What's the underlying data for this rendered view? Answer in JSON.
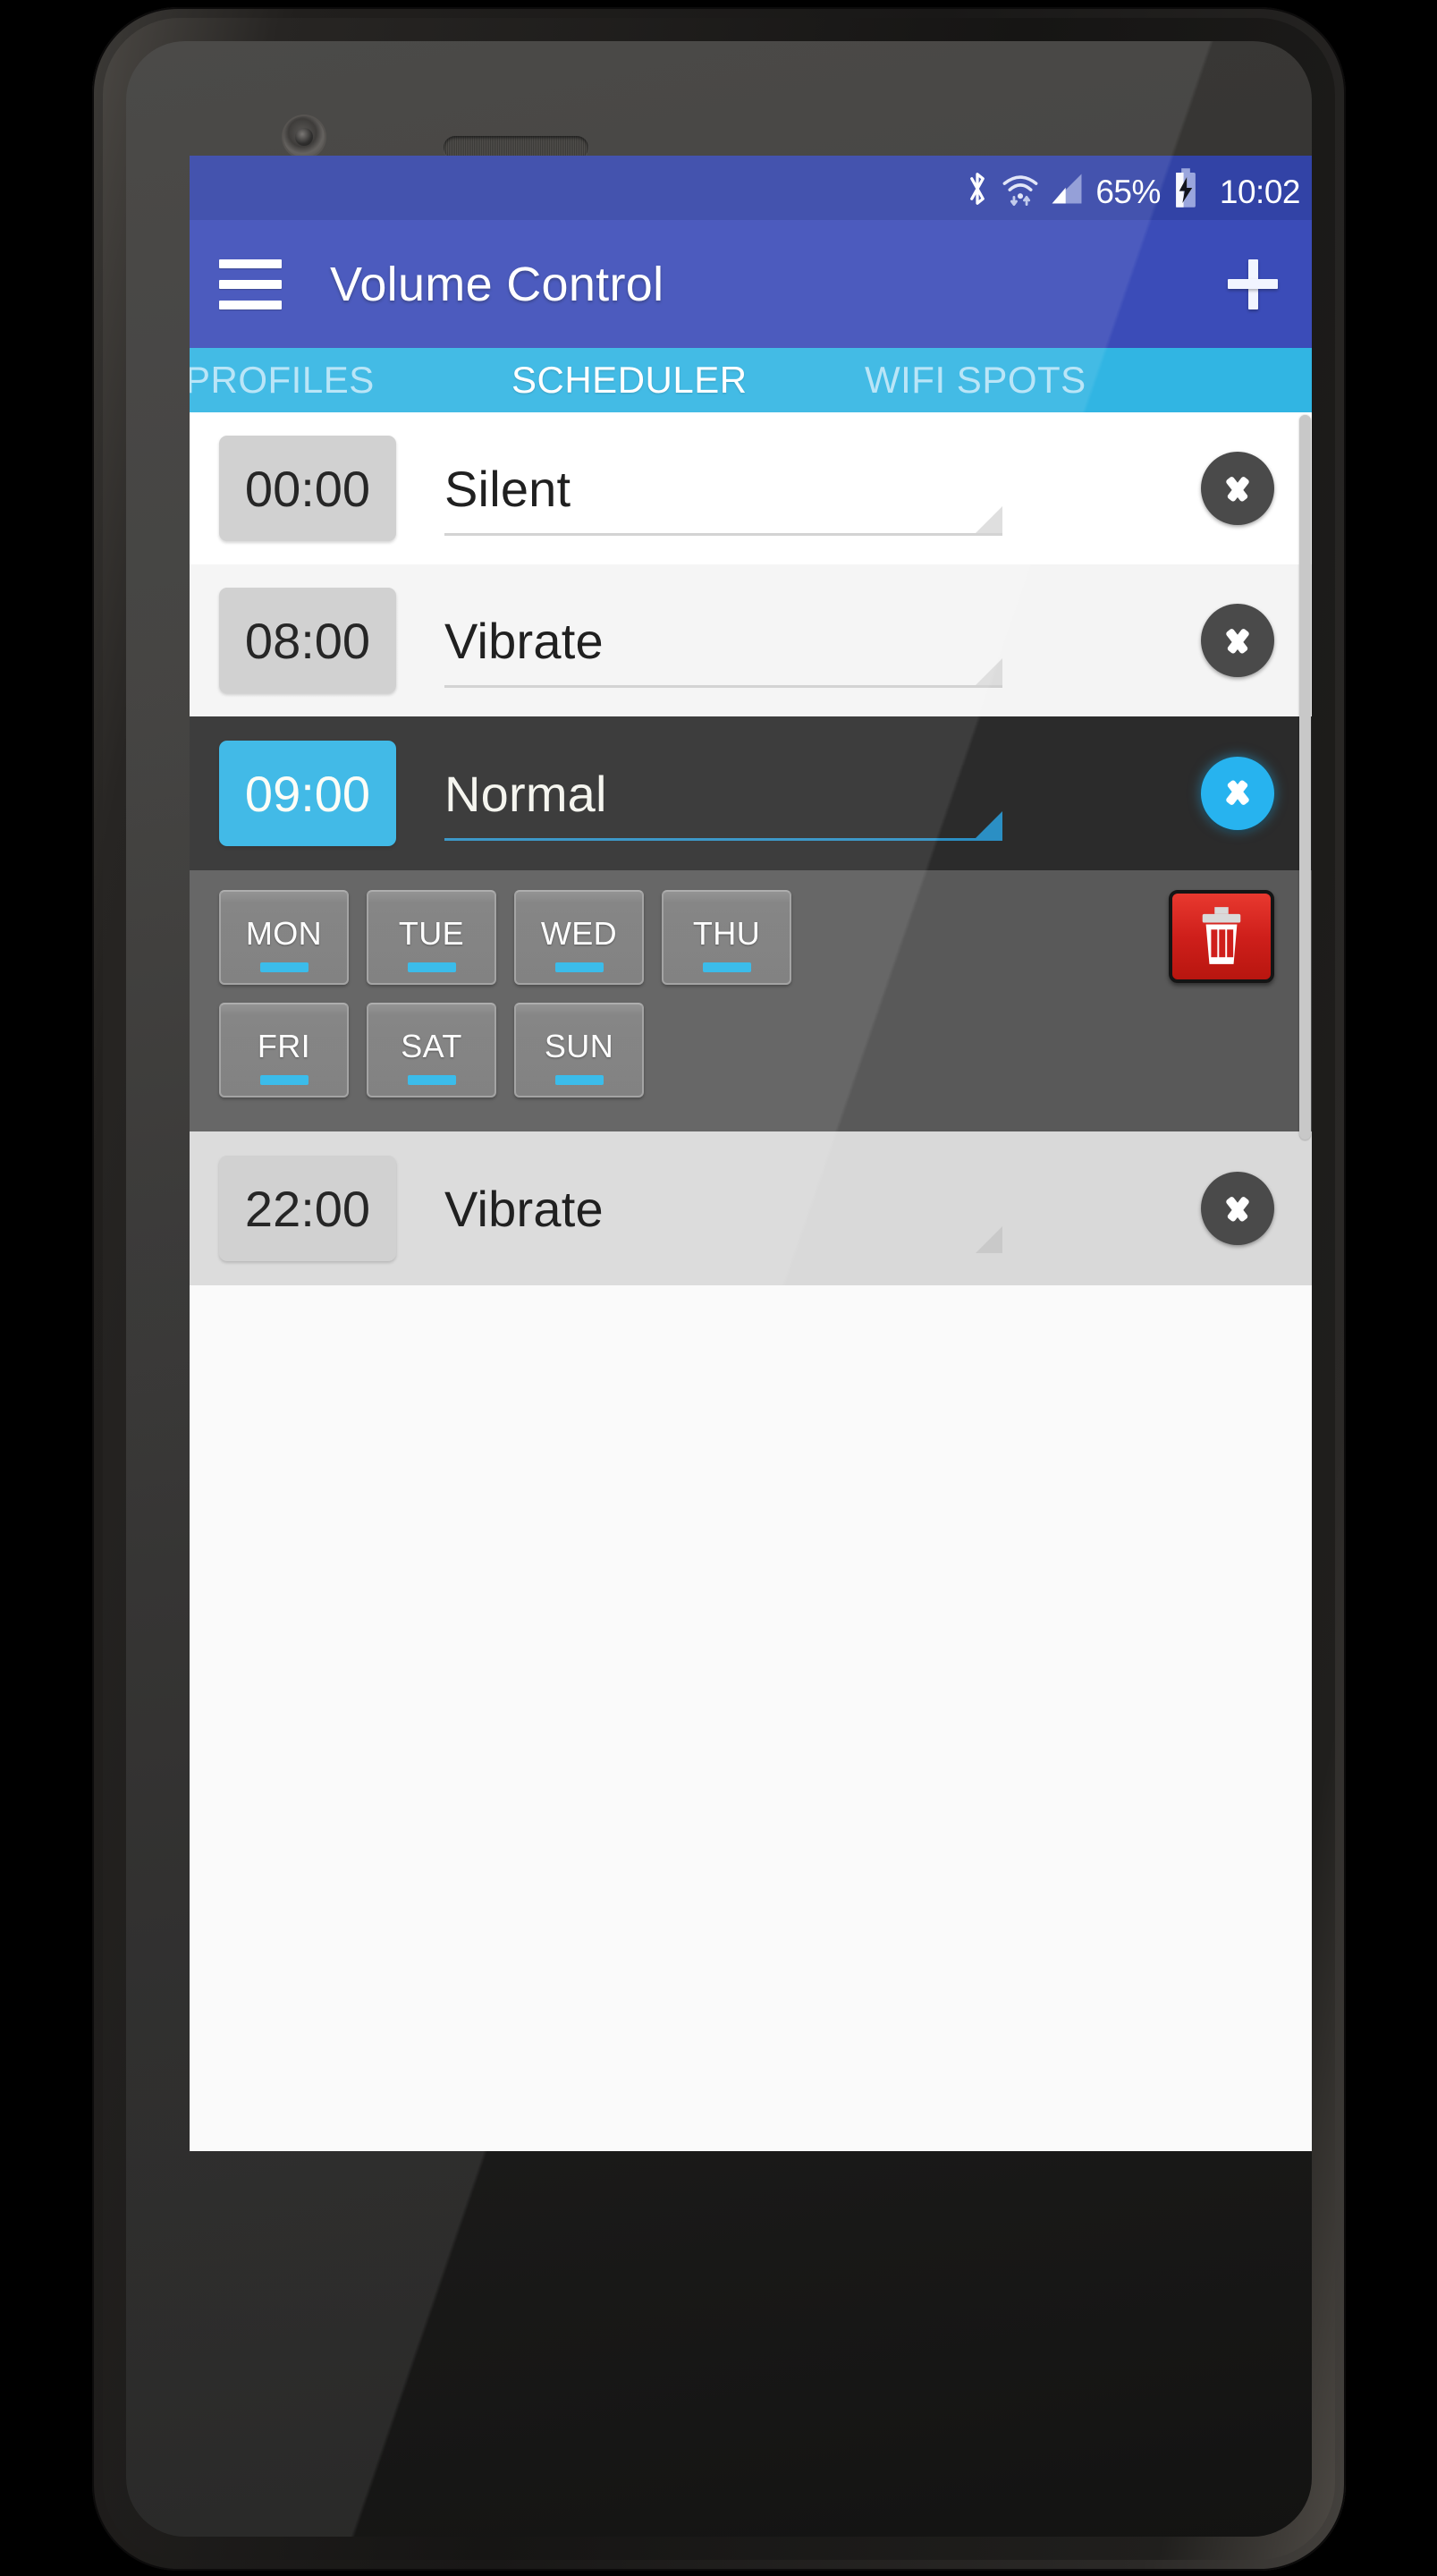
{
  "status_bar": {
    "battery_percent": "65%",
    "clock": "10:02",
    "icons": [
      "bluetooth-icon",
      "wifi-icon",
      "cellular-signal-icon",
      "battery-charging-icon"
    ],
    "background_color": "#3243a6"
  },
  "app_bar": {
    "title": "Volume Control",
    "menu_icon": "hamburger-menu-icon",
    "add_icon": "plus-icon",
    "background_color": "#3b4cb8"
  },
  "tabs": {
    "background_color": "#31b5e3",
    "active_index": 1,
    "items": [
      {
        "label": "PROFILES",
        "active": false
      },
      {
        "label": "SCHEDULER",
        "active": true
      },
      {
        "label": "WIFI SPOTS",
        "active": false
      }
    ]
  },
  "scheduler": {
    "rows": [
      {
        "time": "00:00",
        "profile": "Silent",
        "expanded": false
      },
      {
        "time": "08:00",
        "profile": "Vibrate",
        "expanded": false
      },
      {
        "time": "09:00",
        "profile": "Normal",
        "expanded": true
      },
      {
        "time": "22:00",
        "profile": "Vibrate",
        "expanded": false
      }
    ],
    "expanded_row": {
      "days": [
        {
          "label": "MON",
          "enabled": true
        },
        {
          "label": "TUE",
          "enabled": true
        },
        {
          "label": "WED",
          "enabled": true
        },
        {
          "label": "THU",
          "enabled": true
        },
        {
          "label": "FRI",
          "enabled": true
        },
        {
          "label": "SAT",
          "enabled": true
        },
        {
          "label": "SUN",
          "enabled": true
        }
      ],
      "delete_icon": "trash-icon",
      "panel_color": "#595959",
      "indicator_color": "#29b6e8"
    },
    "colors": {
      "selected_row_bg": "#2b2b2b",
      "selected_chip_bg": "#30b3e5",
      "accent": "#27b3ef",
      "delete_red": "#cf1f1b"
    }
  }
}
